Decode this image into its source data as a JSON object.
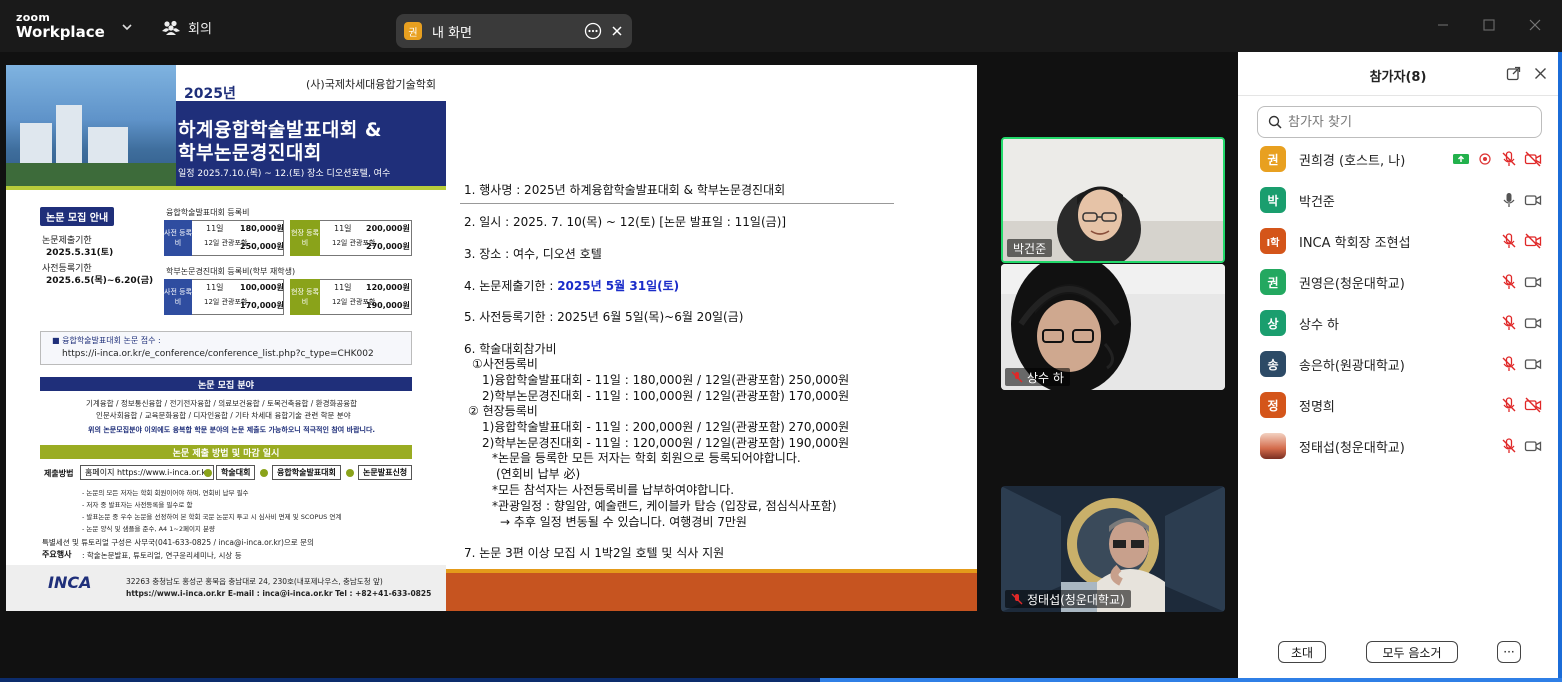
{
  "app": {
    "brand_top": "zoom",
    "brand_main": "Workplace",
    "meeting_label": "회의"
  },
  "share": {
    "avatar_letter": "권",
    "label": "내 화면",
    "avatar_color": "#e8a020"
  },
  "poster": {
    "org": "(사)국제차세대융합기술학회",
    "year": "2025년",
    "title1": "하계융합학술발표대회 &",
    "title2": "학부논문경진대회",
    "date_line": "일정 2025.7.10.(목) ~ 12.(토)   장소 디오션호텔, 여수",
    "section_recruit": "논문 모집 안내",
    "deadline_label": "논문제출기한",
    "deadline_value": "2025.5.31(토)",
    "prereg_label": "사전등록기한",
    "prereg_value": "2025.6.5(목)~6.20(금)",
    "fee_title1": "융합학술발표대회 등록비",
    "fee_title2": "학부논문경진대회 등록비(학부 재학생)",
    "fee_pre": "사전 등록비",
    "fee_onsite": "현장 등록비",
    "fee_11": "11일",
    "fee_12": "12일 관광포함",
    "fee_a1": "180,000원",
    "fee_a2": "250,000원",
    "fee_a3": "200,000원",
    "fee_a4": "270,000원",
    "fee_b1": "100,000원",
    "fee_b2": "170,000원",
    "fee_b3": "120,000원",
    "fee_b4": "190,000원",
    "submit_label": "■ 융합학술발표대회 논문 접수 :",
    "submit_url": "https://i-inca.or.kr/e_conference/conference_list.php?c_type=CHK002",
    "field_bar": "논문 모집 분야",
    "field_line1": "기계융합 / 정보통신융합 / 전기전자융합 / 의료보건융합 / 토목건축융합 / 환경화공융합",
    "field_line2": "인문사회융합 / 교육문화융합 / 디자인융합 / 기타 차세대 융합기술 관련 학문 분야",
    "field_note": "위의 논문모집분야 이외에도 융복합 학문 분야의 논문 제출도 가능하오니 적극적인 참여 바랍니다.",
    "method_bar": "논문 제출 방법 및 마감 일시",
    "method_label": "제출방법",
    "chip1": "홈페이지 https://www.i-inca.or.kr",
    "chip2": "학술대회",
    "chip3": "융합학술발표대회",
    "chip4": "논문발표신청",
    "note1": "- 논문의 모든 저자는 학회 회원이어야 하며, 연회비 납부 필수",
    "note2": "- 저자 중 발표자는 사전등록을 필수로 함",
    "note3": "- 발표논문 중 우수 논문을 선정하여 본 학회 국문 논문지 투고 시 심사비 면제 및 SCOPUS 연계",
    "note4": "- 논문 양식 및 샘플을 준수, A4 1~2페이지 분량",
    "special": "특별세션 및 튜토리얼 구성은 사무국(041-633-0825 / inca@i-inca.or.kr)으로 문의",
    "main_label": "주요행사",
    "main_value": ": 학술논문발표, 튜토리얼, 연구윤리세미나, 시상 등",
    "foot_logo": "INCA",
    "foot_addr": "32263 충청남도 홍성군 홍북읍 충남대로 24, 230호(내포제나우스, 충남도청 앞)",
    "foot_web": "https://www.i-inca.or.kr   E-mail : inca@i-inca.or.kr   Tel : +82+41-633-0825"
  },
  "notice": {
    "l1": "1. 행사명 : 2025년 하계융합학술발표대회 & 학부논문경진대회",
    "l2": "2. 일시 : 2025. 7. 10(목) ~ 12(토) [논문 발표일 : 11일(금)]",
    "l3": "3. 장소 : 여수, 디오션 호텔",
    "l4a": "4. 논문제출기한 : ",
    "l4b": "2025년 5월 31일(토)",
    "l5": "5. 사전등록기한 : 2025년 6월 5일(목)~6월 20일(금)",
    "l6": "6. 학술대회참가비",
    "l6a": "①사전등록비",
    "l6a1": "1)융합학술발표대회 - 11일 : 180,000원 / 12일(관광포함) 250,000원",
    "l6a2": "2)학부논문경진대회 - 11일 : 100,000원 / 12일(관광포함) 170,000원",
    "l6b": "② 현장등록비",
    "l6b1": "1)융합학술발표대회 - 11일 : 200,000원 / 12일(관광포함) 270,000원",
    "l6b2": "2)학부논문경진대회 - 11일 : 120,000원 / 12일(관광포함) 190,000원",
    "n1": "*논문을 등록한 모든 저자는 학회 회원으로 등록되어야합니다.",
    "n1b": "(연회비 납부 必)",
    "n2": "*모든 참석자는 사전등록비를 납부하여야합니다.",
    "n3": "*관광일정 : 향일암, 예술랜드, 케이블카 탑승 (입장료, 점심식사포함)",
    "n3b": "→ 추후 일정 변동될 수 있습니다. 여행경비 7만원",
    "l7": "7. 논문 3편 이상 모집 시 1박2일 호텔 및 식사 지원"
  },
  "videos": [
    {
      "name": "박건준",
      "muted": false
    },
    {
      "name": "상수 하",
      "muted": true
    },
    {
      "name": "정태섭(청운대학교)",
      "muted": true
    }
  ],
  "panel": {
    "title": "참가자(8)",
    "search_placeholder": "참가자 찾기",
    "participants": [
      {
        "letter": "권",
        "name": "권희경 (호스트, 나)",
        "color": "#e8a020",
        "mic": "muted",
        "cam": "off"
      },
      {
        "letter": "박",
        "name": "박건준",
        "color": "#1a9e6e",
        "mic": "on",
        "cam": "on"
      },
      {
        "letter": "I학",
        "name": "INCA 학회장 조현섭",
        "color": "#d4551a",
        "mic": "muted",
        "cam": "off"
      },
      {
        "letter": "권",
        "name": "권영은(청운대학교)",
        "color": "#23a860",
        "mic": "muted",
        "cam": "on"
      },
      {
        "letter": "상",
        "name": "상수 하",
        "color": "#1a9e6e",
        "mic": "muted",
        "cam": "on"
      },
      {
        "letter": "송",
        "name": "송은하(원광대학교)",
        "color": "#2c4a66",
        "mic": "muted",
        "cam": "on"
      },
      {
        "letter": "정",
        "name": "정명희",
        "color": "#d4551a",
        "mic": "muted",
        "cam": "off"
      },
      {
        "letter": "",
        "name": "정태섭(청운대학교)",
        "color": "#b5543a",
        "mic": "muted",
        "cam": "on"
      }
    ],
    "invite_label": "초대",
    "mute_all_label": "모두 음소거",
    "more_label": "···"
  }
}
